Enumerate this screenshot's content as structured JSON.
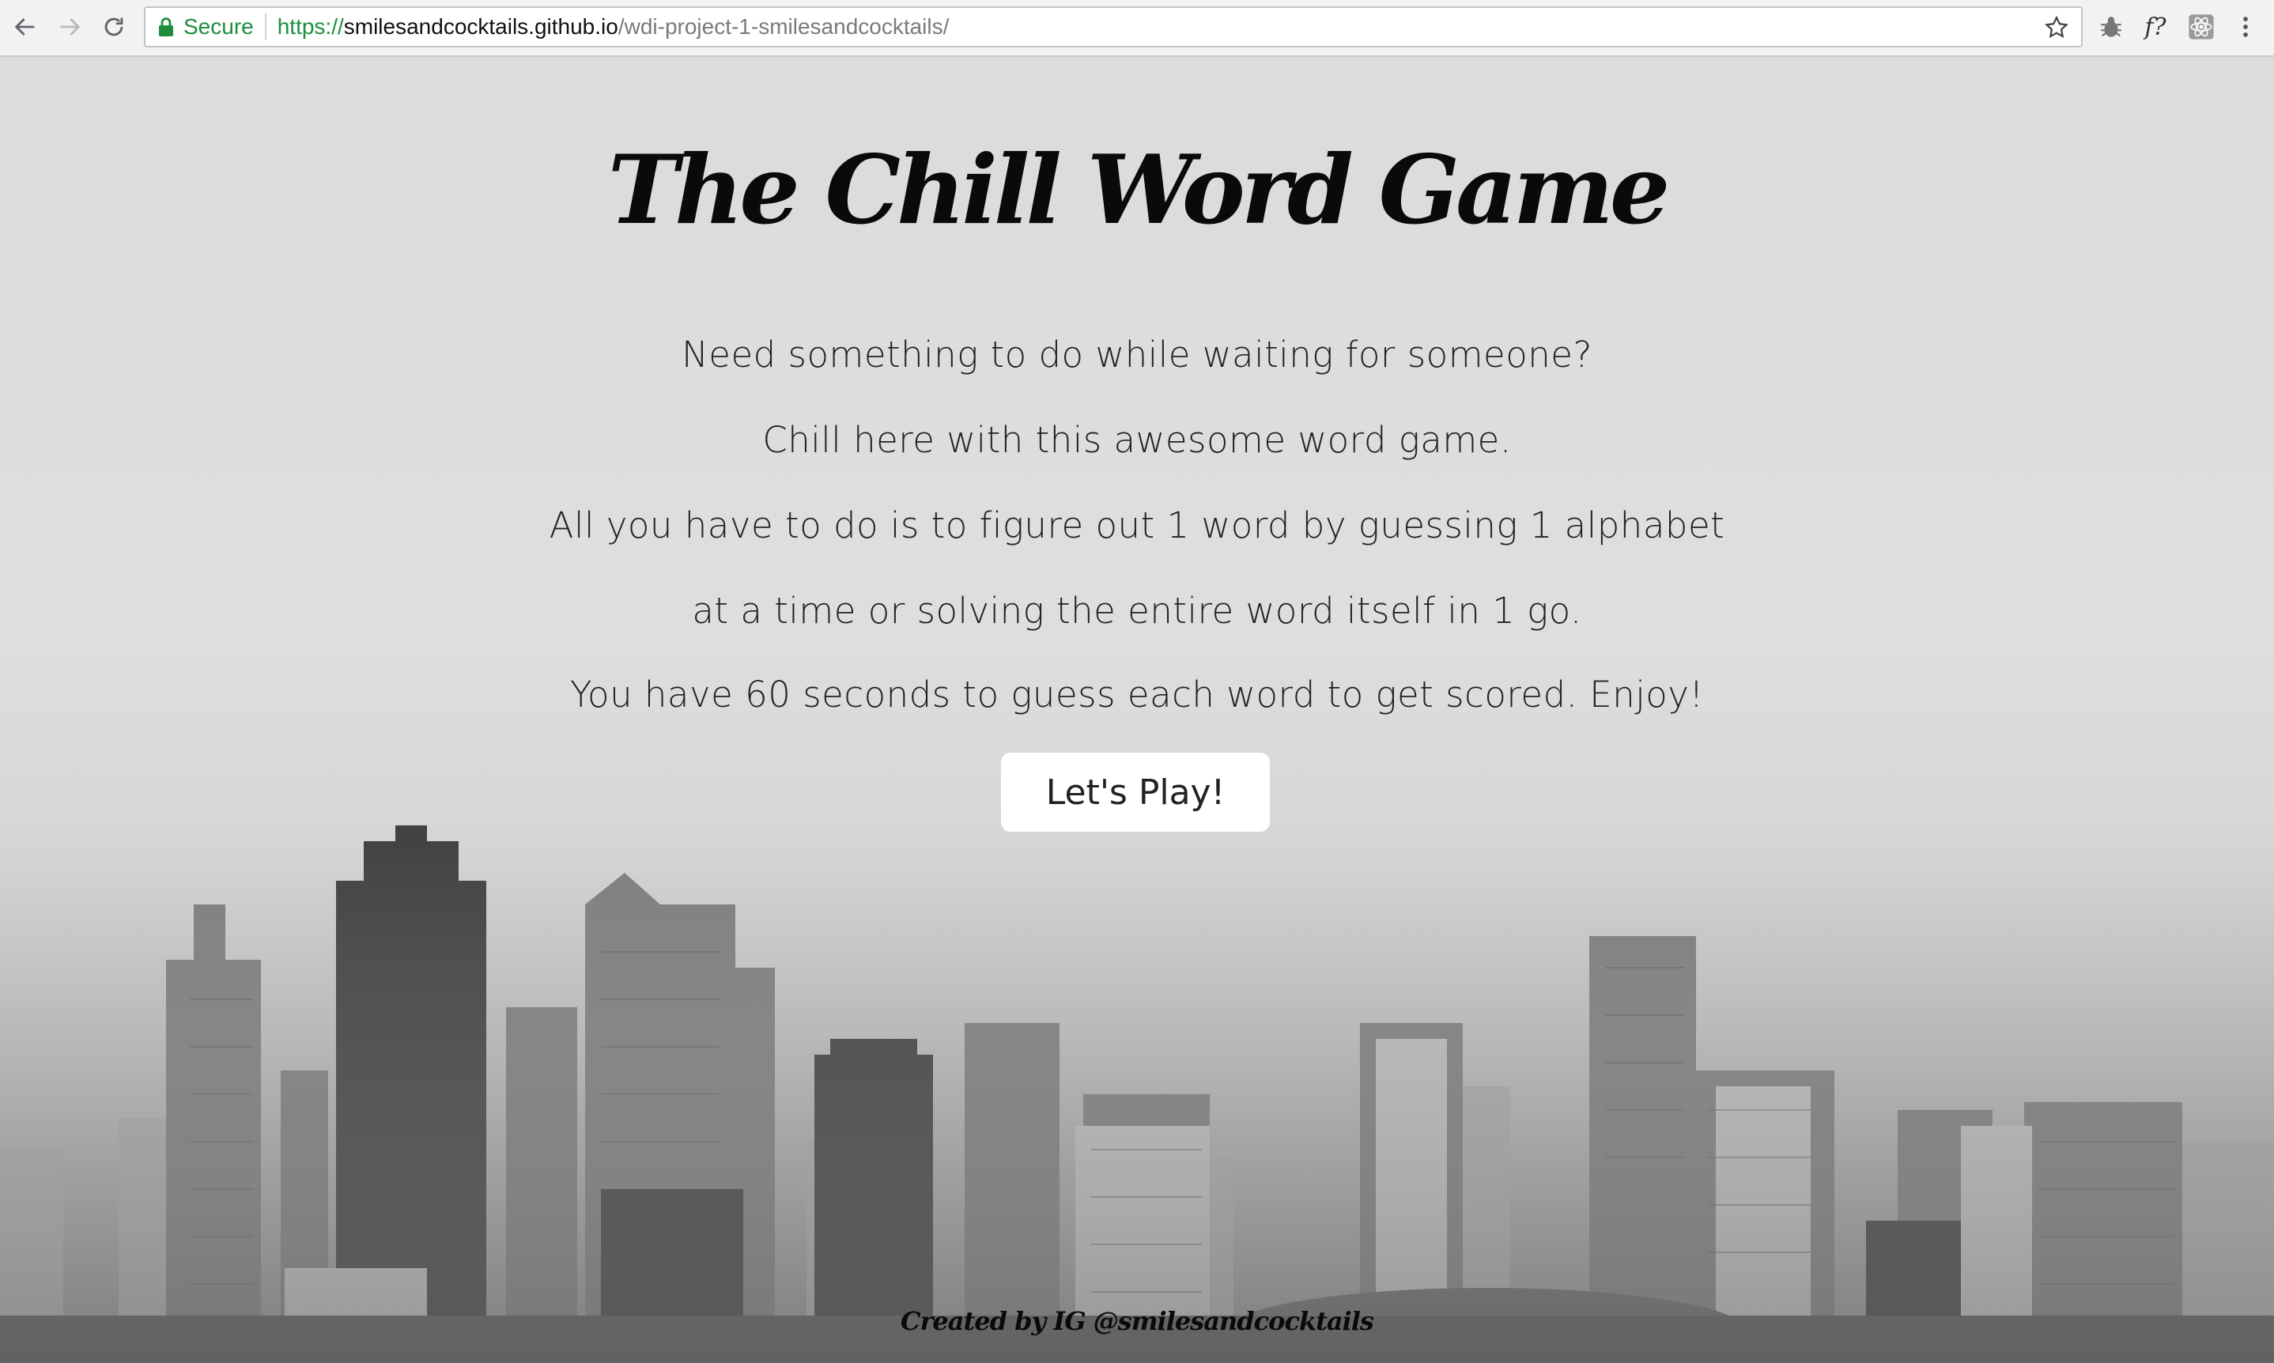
{
  "browser": {
    "secure_label": "Secure",
    "url_scheme": "https://",
    "url_host": "smilesandcocktails.github.io",
    "url_path": "/wdi-project-1-smilesandcocktails/",
    "extensions": [
      "bug-icon",
      "font-identifier-icon",
      "react-devtools-icon",
      "menu-icon"
    ],
    "font_ext_label": "f?"
  },
  "game": {
    "title": "The Chill Word Game",
    "intro_lines": [
      "Need something to do while waiting for someone?",
      "Chill here with this awesome word game.",
      "All you have to do is to figure out 1 word by guessing 1 alphabet",
      "at a time or solving the entire word itself in 1 go.",
      "You have 60 seconds to guess each word to get scored. Enjoy!"
    ],
    "play_button": "Let's Play!",
    "credit": "Created by IG @smilesandcocktails"
  },
  "colors": {
    "secure_green": "#1e8e3e",
    "background_gray": "#dcdcdc",
    "button_bg": "#ffffff"
  }
}
